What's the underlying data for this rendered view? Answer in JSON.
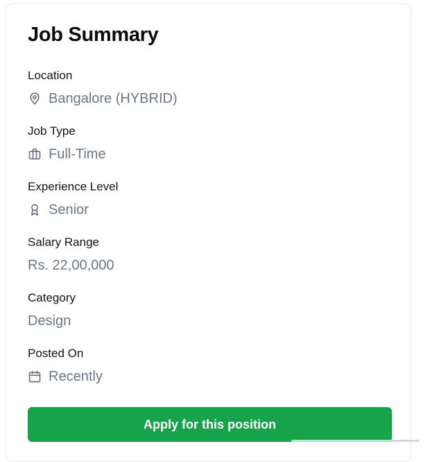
{
  "card": {
    "title": "Job Summary",
    "fields": [
      {
        "label": "Location",
        "value": "Bangalore (HYBRID)",
        "icon": "map-pin-icon"
      },
      {
        "label": "Job Type",
        "value": "Full-Time",
        "icon": "briefcase-icon"
      },
      {
        "label": "Experience Level",
        "value": "Senior",
        "icon": "award-icon"
      },
      {
        "label": "Salary Range",
        "value": "Rs. 22,00,000",
        "icon": ""
      },
      {
        "label": "Category",
        "value": "Design",
        "icon": ""
      },
      {
        "label": "Posted On",
        "value": "Recently",
        "icon": "calendar-icon"
      }
    ],
    "apply_label": "Apply for this position"
  },
  "colors": {
    "accent": "#16a34a",
    "label": "#111111",
    "value": "#6b7785",
    "border": "#e5e7eb"
  }
}
